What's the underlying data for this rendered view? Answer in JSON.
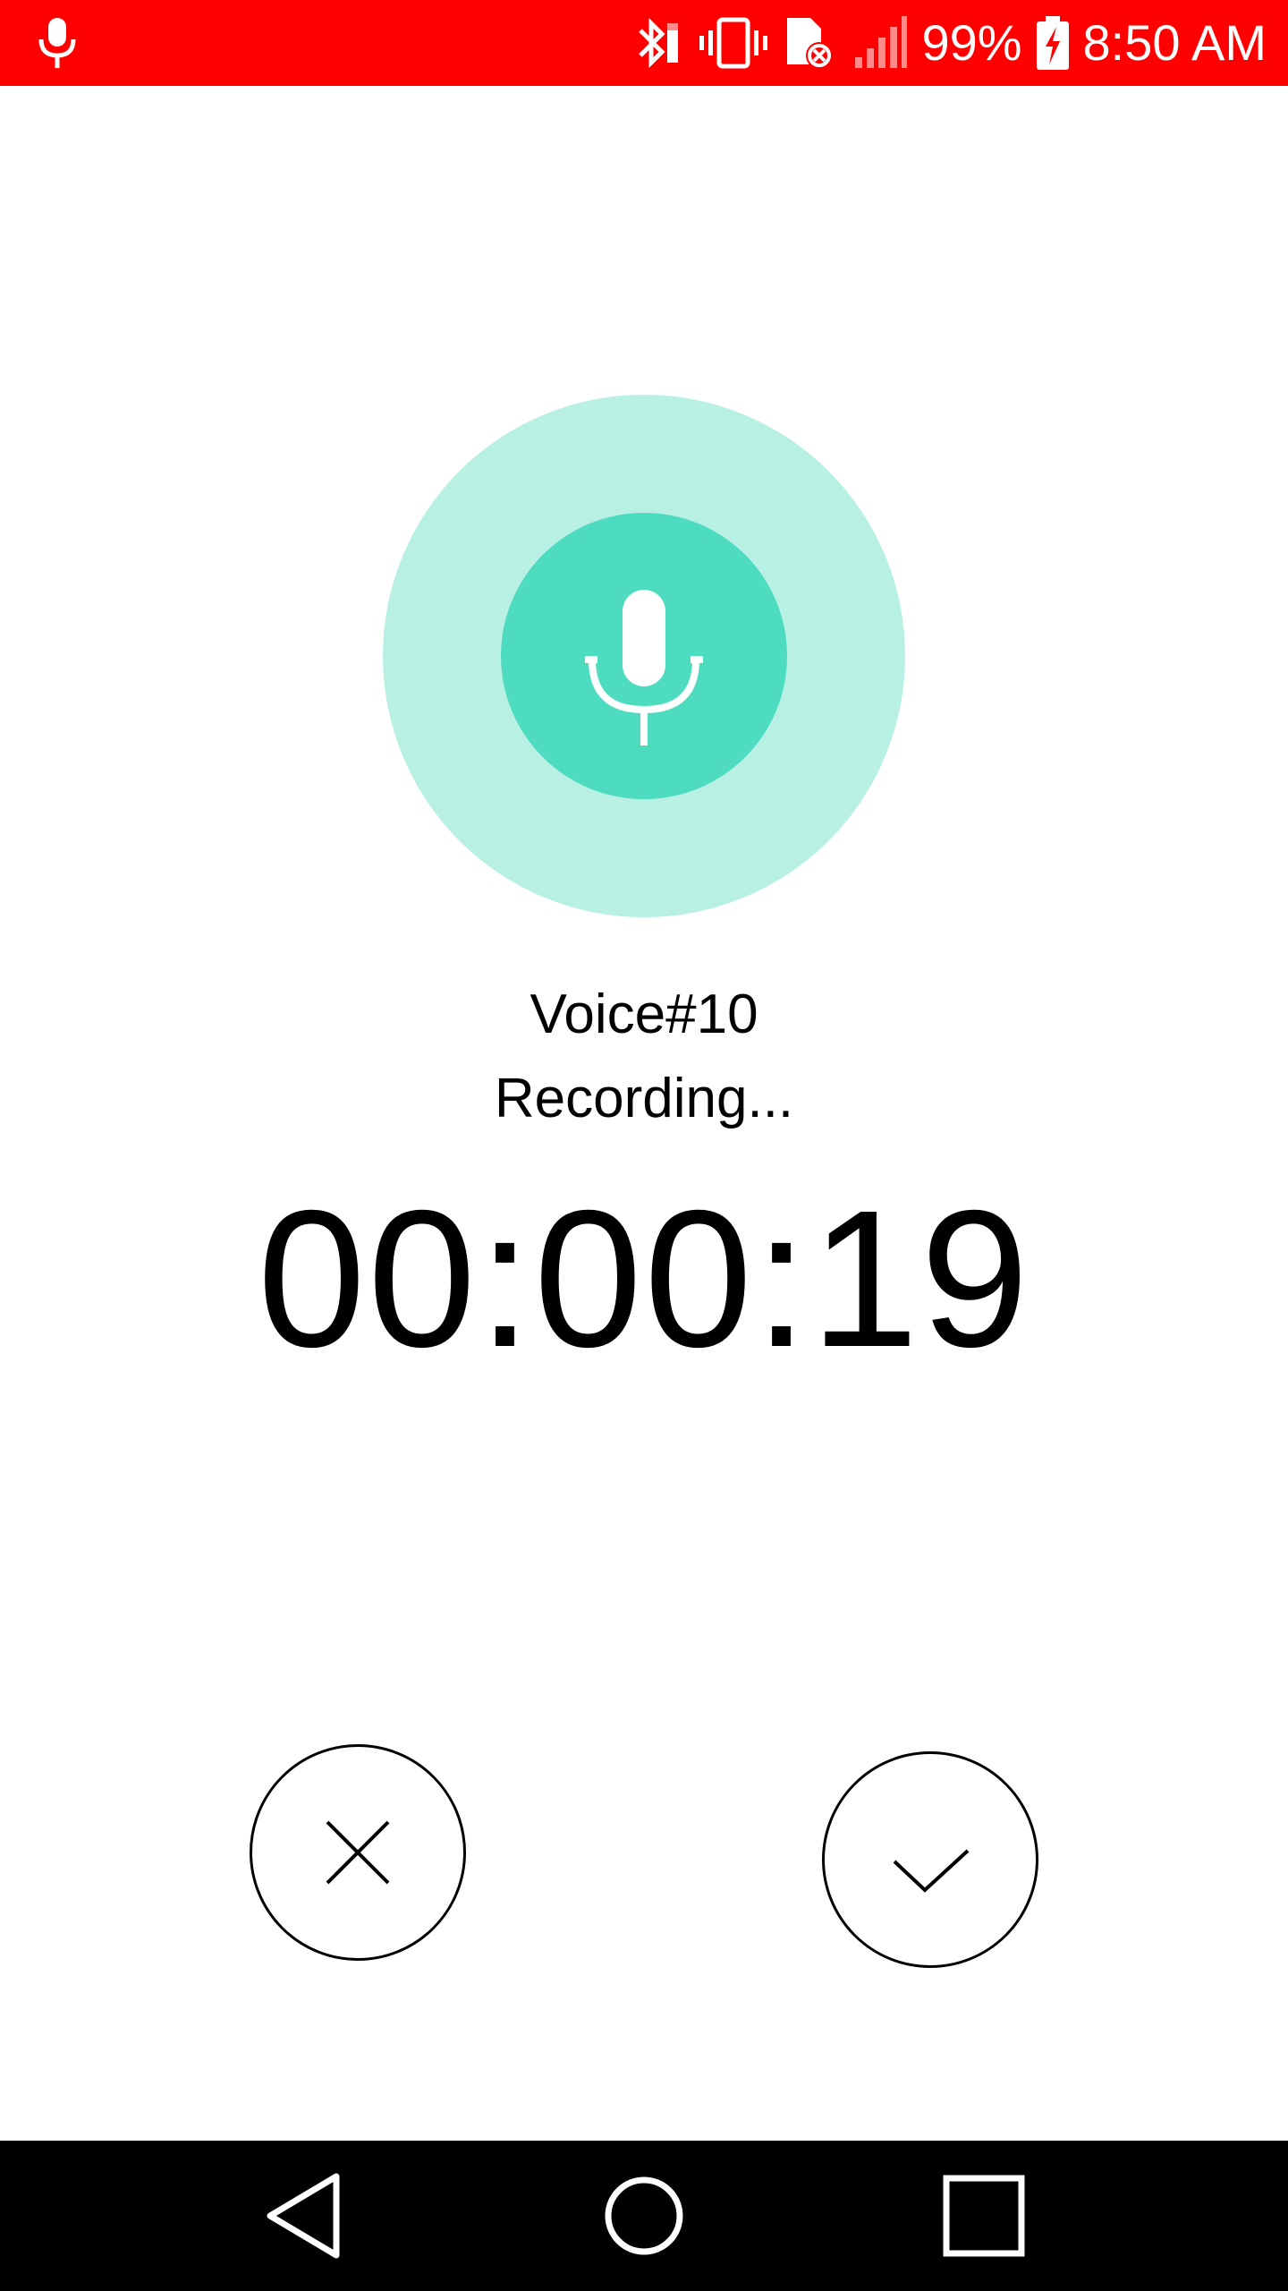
{
  "status_bar": {
    "battery_percent": "99%",
    "time": "8:50 AM",
    "background_color": "#fe0000",
    "icons": [
      "microphone-icon",
      "bluetooth-icon",
      "vibrate-icon",
      "no-sim-icon",
      "signal-icon",
      "battery-charging-icon"
    ]
  },
  "recorder": {
    "title": "Voice#10",
    "status": "Recording...",
    "elapsed": "00:00:19",
    "outer_ring_color": "#b8f0e4",
    "inner_circle_color": "#4edcc1"
  },
  "actions": {
    "cancel_icon": "close-icon",
    "confirm_icon": "check-icon"
  },
  "nav_bar": {
    "buttons": [
      "back-icon",
      "home-icon",
      "recents-icon"
    ]
  }
}
